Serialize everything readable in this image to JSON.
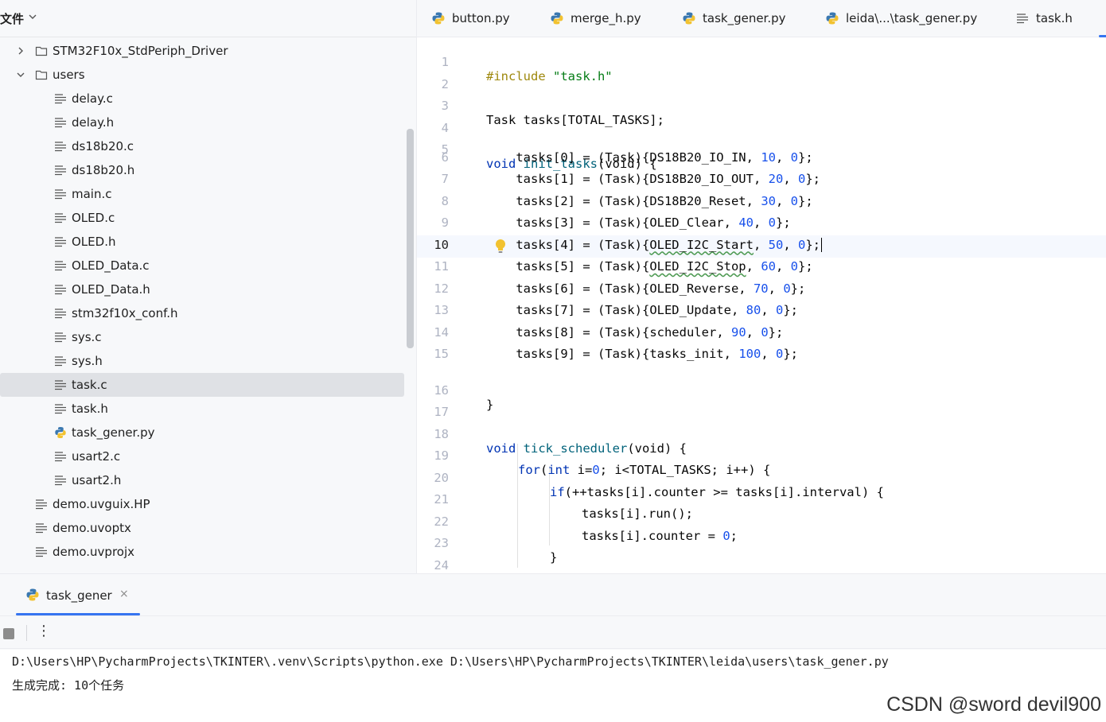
{
  "project_panel": {
    "title": "文件",
    "items": [
      {
        "label": "STM32F10x_StdPeriph_Driver",
        "type": "folder",
        "expanded": false
      },
      {
        "label": "users",
        "type": "folder",
        "expanded": true
      },
      {
        "label": "delay.c",
        "type": "file"
      },
      {
        "label": "delay.h",
        "type": "file"
      },
      {
        "label": "ds18b20.c",
        "type": "file"
      },
      {
        "label": "ds18b20.h",
        "type": "file"
      },
      {
        "label": "main.c",
        "type": "file"
      },
      {
        "label": "OLED.c",
        "type": "file"
      },
      {
        "label": "OLED.h",
        "type": "file"
      },
      {
        "label": "OLED_Data.c",
        "type": "file"
      },
      {
        "label": "OLED_Data.h",
        "type": "file"
      },
      {
        "label": "stm32f10x_conf.h",
        "type": "file"
      },
      {
        "label": "sys.c",
        "type": "file"
      },
      {
        "label": "sys.h",
        "type": "file"
      },
      {
        "label": "task.c",
        "type": "file",
        "selected": true
      },
      {
        "label": "task.h",
        "type": "file"
      },
      {
        "label": "task_gener.py",
        "type": "python"
      },
      {
        "label": "usart2.c",
        "type": "file"
      },
      {
        "label": "usart2.h",
        "type": "file"
      },
      {
        "label": "demo.uvguix.HP",
        "type": "file"
      },
      {
        "label": "demo.uvoptx",
        "type": "file"
      },
      {
        "label": "demo.uvprojx",
        "type": "file"
      }
    ]
  },
  "editor": {
    "tabs": [
      {
        "label": "button.py",
        "icon": "python-icon"
      },
      {
        "label": "merge_h.py",
        "icon": "python-icon"
      },
      {
        "label": "task_gener.py",
        "icon": "python-icon"
      },
      {
        "label": "leida\\...\\task_gener.py",
        "icon": "python-icon"
      },
      {
        "label": "task.h",
        "icon": "text-file-icon"
      }
    ],
    "active_line": 10,
    "line_numbers": [
      "1",
      "2",
      "3",
      "4",
      "5",
      "6",
      "7",
      "8",
      "9",
      "10",
      "11",
      "12",
      "13",
      "14",
      "15",
      "16",
      "17",
      "18",
      "19",
      "20",
      "21",
      "22",
      "23",
      "24"
    ],
    "code": {
      "l1_pp": "#include",
      "l1_str": " \"task.h\"",
      "l3": "Task tasks[TOTAL_TASKS];",
      "l5_kw": "void",
      "l5_fn": " init_tasks",
      "l5_rest": "(void) {",
      "tasks": [
        {
          "pre": "    tasks[0] = (Task){",
          "name": "DS18B20_IO_IN",
          "val": "10"
        },
        {
          "pre": "    tasks[1] = (Task){",
          "name": "DS18B20_IO_OUT",
          "val": "20"
        },
        {
          "pre": "    tasks[2] = (Task){",
          "name": "DS18B20_Reset",
          "val": "30"
        },
        {
          "pre": "    tasks[3] = (Task){",
          "name": "OLED_Clear",
          "val": "40"
        },
        {
          "pre": "    tasks[4] = (Task){",
          "name": "OLED_I2C_Start",
          "val": "50"
        },
        {
          "pre": "    tasks[5] = (Task){",
          "name": "OLED_I2C_Stop",
          "val": "60"
        },
        {
          "pre": "    tasks[6] = (Task){",
          "name": "OLED_Reverse",
          "val": "70"
        },
        {
          "pre": "    tasks[7] = (Task){",
          "name": "OLED_Update",
          "val": "80"
        },
        {
          "pre": "    tasks[8] = (Task){",
          "name": "scheduler",
          "val": "90"
        },
        {
          "pre": "    tasks[9] = (Task){",
          "name": "tasks_init",
          "val": "100"
        }
      ],
      "zero": "0",
      "sep": ", ",
      "end": "};",
      "l16": "}",
      "l18_kw": "void",
      "l18_fn": " tick_scheduler",
      "l18_rest": "(void) {",
      "l19_kw": "for",
      "l19_a": "(",
      "l19_kw2": "int",
      "l19_b": " i=",
      "l19_num": "0",
      "l19_c": "; i<TOTAL_TASKS; i++) {",
      "l20_kw": "if",
      "l20_rest": "(++tasks[i].counter >= tasks[i].interval) {",
      "l21": "tasks[i].run();",
      "l22_a": "tasks[i].counter = ",
      "l22_num": "0",
      "l22_b": ";",
      "l23": "}",
      "l24": "}"
    }
  },
  "run_panel": {
    "tab_label": "task_gener",
    "close_glyph": "×",
    "more_glyph": "⋮",
    "console": [
      "D:\\Users\\HP\\PycharmProjects\\TKINTER\\.venv\\Scripts\\python.exe D:\\Users\\HP\\PycharmProjects\\TKINTER\\leida\\users\\task_gener.py",
      "生成完成: 10个任务"
    ]
  },
  "watermark": "CSDN @sword devil900",
  "colors": {
    "keyword": "#0033b3",
    "preprocessor": "#9e880d",
    "string": "#067d17",
    "number": "#1750eb",
    "accent": "#3574f0",
    "selection": "#dfe1e5"
  }
}
